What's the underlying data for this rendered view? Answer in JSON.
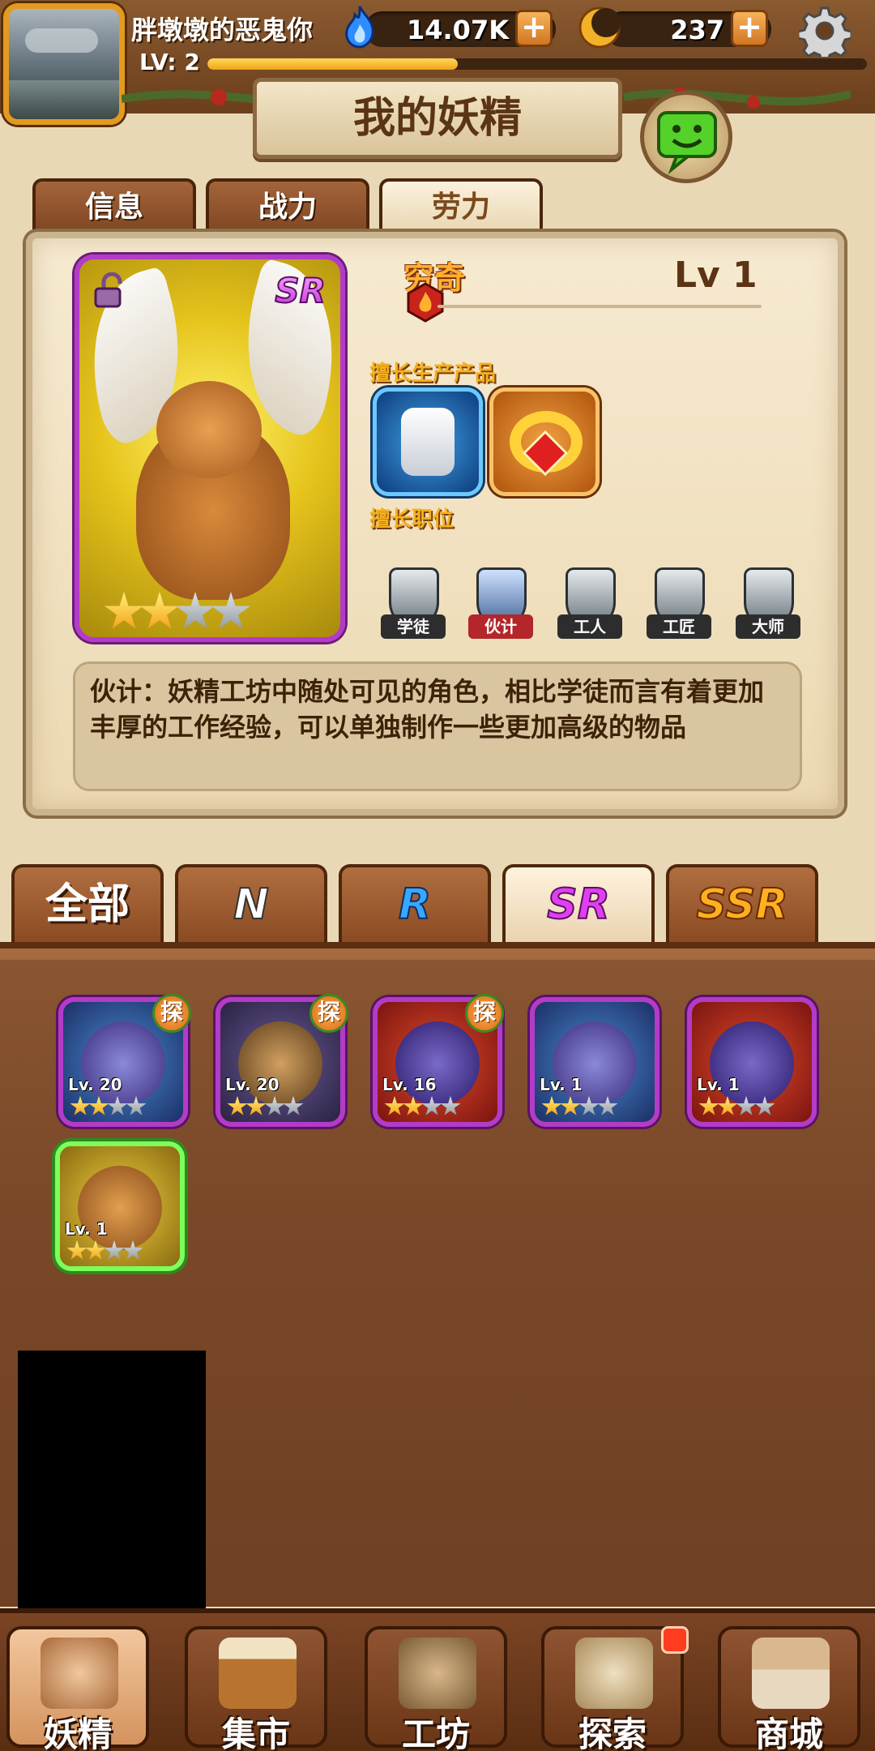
{
  "player": {
    "name": "胖墩墩的恶鬼你",
    "level_label": "LV: 2",
    "xp_fraction": 0.38
  },
  "currencies": {
    "soul_fire": {
      "value": "14.07K",
      "icon": "blue-flame-icon",
      "plus": "+"
    },
    "moon_coin": {
      "value": "237",
      "icon": "crescent-moon-icon",
      "plus": "+"
    }
  },
  "page_title": "我的妖精",
  "detail_tabs": [
    "信息",
    "战力",
    "劳力"
  ],
  "active_detail_tab": 2,
  "fairy": {
    "rarity": "SR",
    "name": "穷奇",
    "level": "Lv 1",
    "stars_on": 2,
    "stars_total": 4,
    "products_label": "擅长生产产品",
    "roles_label": "擅长职位",
    "roles": [
      "学徒",
      "伙计",
      "工人",
      "工匠",
      "大师"
    ],
    "highlight_role": 1,
    "description": "伙计：妖精工坊中随处可见的角色，相比学徒而言有着更加丰厚的工作经验，可以单独制作一些更加高级的物品"
  },
  "rarity_filters": [
    "全部",
    "N",
    "R",
    "SR",
    "SSR"
  ],
  "active_filter": 3,
  "fairy_list": [
    {
      "level": "Lv. 20",
      "explore": "探",
      "stars_on": 2
    },
    {
      "level": "Lv. 20",
      "explore": "探",
      "stars_on": 2
    },
    {
      "level": "Lv. 16",
      "explore": "探",
      "stars_on": 2
    },
    {
      "level": "Lv. 1",
      "explore": "",
      "stars_on": 2
    },
    {
      "level": "Lv. 1",
      "explore": "",
      "stars_on": 2
    },
    {
      "level": "Lv. 1",
      "explore": "",
      "stars_on": 2
    }
  ],
  "bottom_nav": [
    "妖精",
    "集市",
    "工坊",
    "探索",
    "商城"
  ],
  "colors": {
    "sr_border": "#b43bc8",
    "selected_border": "#7dff5a",
    "accent_gold": "#f4b021"
  }
}
